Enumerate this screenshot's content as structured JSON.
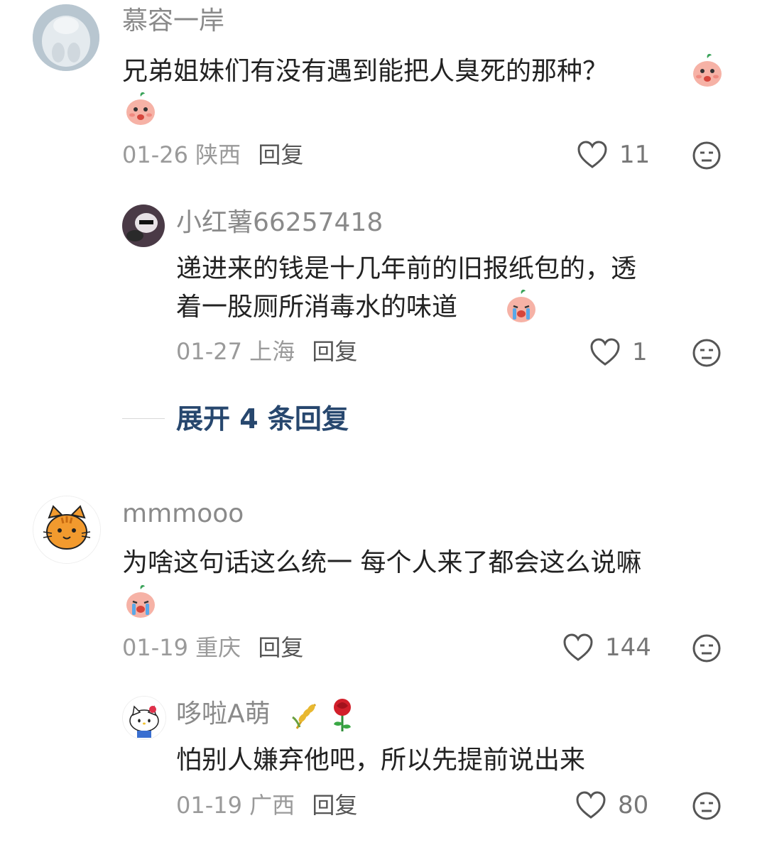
{
  "comments": [
    {
      "username": "慕容一岸",
      "text": "兄弟姐妹们有没有遇到能把人臭死的那种？",
      "date": "01-26",
      "region": "陕西",
      "reply_label": "回复",
      "likes": "11",
      "avatar_icon": "bunny-photo-avatar",
      "emoji": [
        "peach-blush-emoji",
        "peach-blush-emoji"
      ]
    },
    {
      "username": "mmmooo",
      "text": "为啥这句话这么统一 每个人来了都会这么说嘛",
      "date": "01-19",
      "region": "重庆",
      "reply_label": "回复",
      "likes": "144",
      "avatar_icon": "orange-cat-avatar",
      "emoji": [
        "peach-crying-emoji"
      ]
    }
  ],
  "replies": [
    {
      "username": "小红薯66257418",
      "text_line1": "递进来的钱是十几年前的旧报纸包的，透",
      "text_line2": "着一股厕所消毒水的味道",
      "date": "01-27",
      "region": "上海",
      "reply_label": "回复",
      "likes": "1",
      "avatar_icon": "cat-photo-avatar",
      "emoji": [
        "peach-crying-emoji"
      ]
    },
    {
      "username": "哆啦A萌",
      "badges": [
        "wheat-icon",
        "rose-icon"
      ],
      "text": "怕别人嫌弃他吧，所以先提前说出来",
      "date": "01-19",
      "region": "广西",
      "reply_label": "回复",
      "likes": "80",
      "avatar_icon": "hello-kitty-avatar"
    }
  ],
  "expand_label": "展开 4 条回复",
  "colors": {
    "accent_link": "#27476e",
    "meta_gray": "#9a9a9a",
    "name_gray": "#8a8a8a"
  }
}
